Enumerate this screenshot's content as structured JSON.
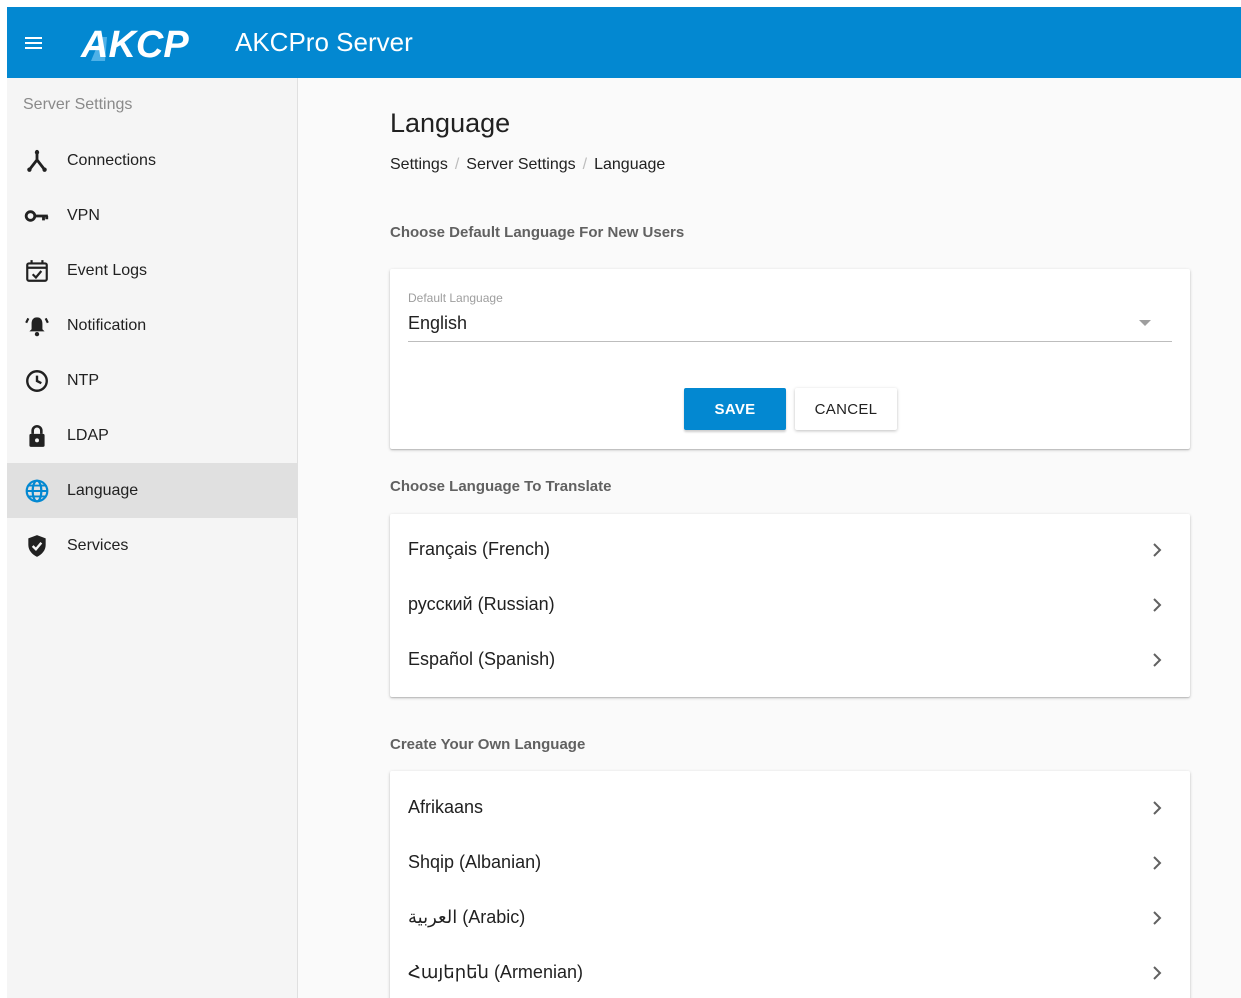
{
  "app": {
    "logo_text": "AKCP",
    "title": "AKCPro Server"
  },
  "sidebar": {
    "header": "Server Settings",
    "items": [
      {
        "label": "Connections",
        "icon": "connections-icon"
      },
      {
        "label": "VPN",
        "icon": "key-icon"
      },
      {
        "label": "Event Logs",
        "icon": "calendar-check-icon"
      },
      {
        "label": "Notification",
        "icon": "bell-ringing-icon"
      },
      {
        "label": "NTP",
        "icon": "clock-icon"
      },
      {
        "label": "LDAP",
        "icon": "lock-icon"
      },
      {
        "label": "Language",
        "icon": "globe-icon",
        "active": true
      },
      {
        "label": "Services",
        "icon": "shield-check-icon"
      }
    ]
  },
  "main": {
    "title": "Language",
    "breadcrumb": [
      "Settings",
      "Server Settings",
      "Language"
    ],
    "default_section": {
      "title": "Choose Default Language For New Users",
      "field_label": "Default Language",
      "field_value": "English",
      "save_label": "SAVE",
      "cancel_label": "CANCEL"
    },
    "translate_section": {
      "title": "Choose Language To Translate",
      "items": [
        "Français (French)",
        "русский (Russian)",
        "Español (Spanish)"
      ]
    },
    "create_section": {
      "title": "Create Your Own Language",
      "items": [
        "Afrikaans",
        "Shqip (Albanian)",
        "العربية (Arabic)",
        "Հայերեն (Armenian)"
      ]
    }
  },
  "colors": {
    "primary": "#0388d1",
    "sidebar_bg": "#f5f5f5",
    "active_bg": "#e0e0e0"
  }
}
